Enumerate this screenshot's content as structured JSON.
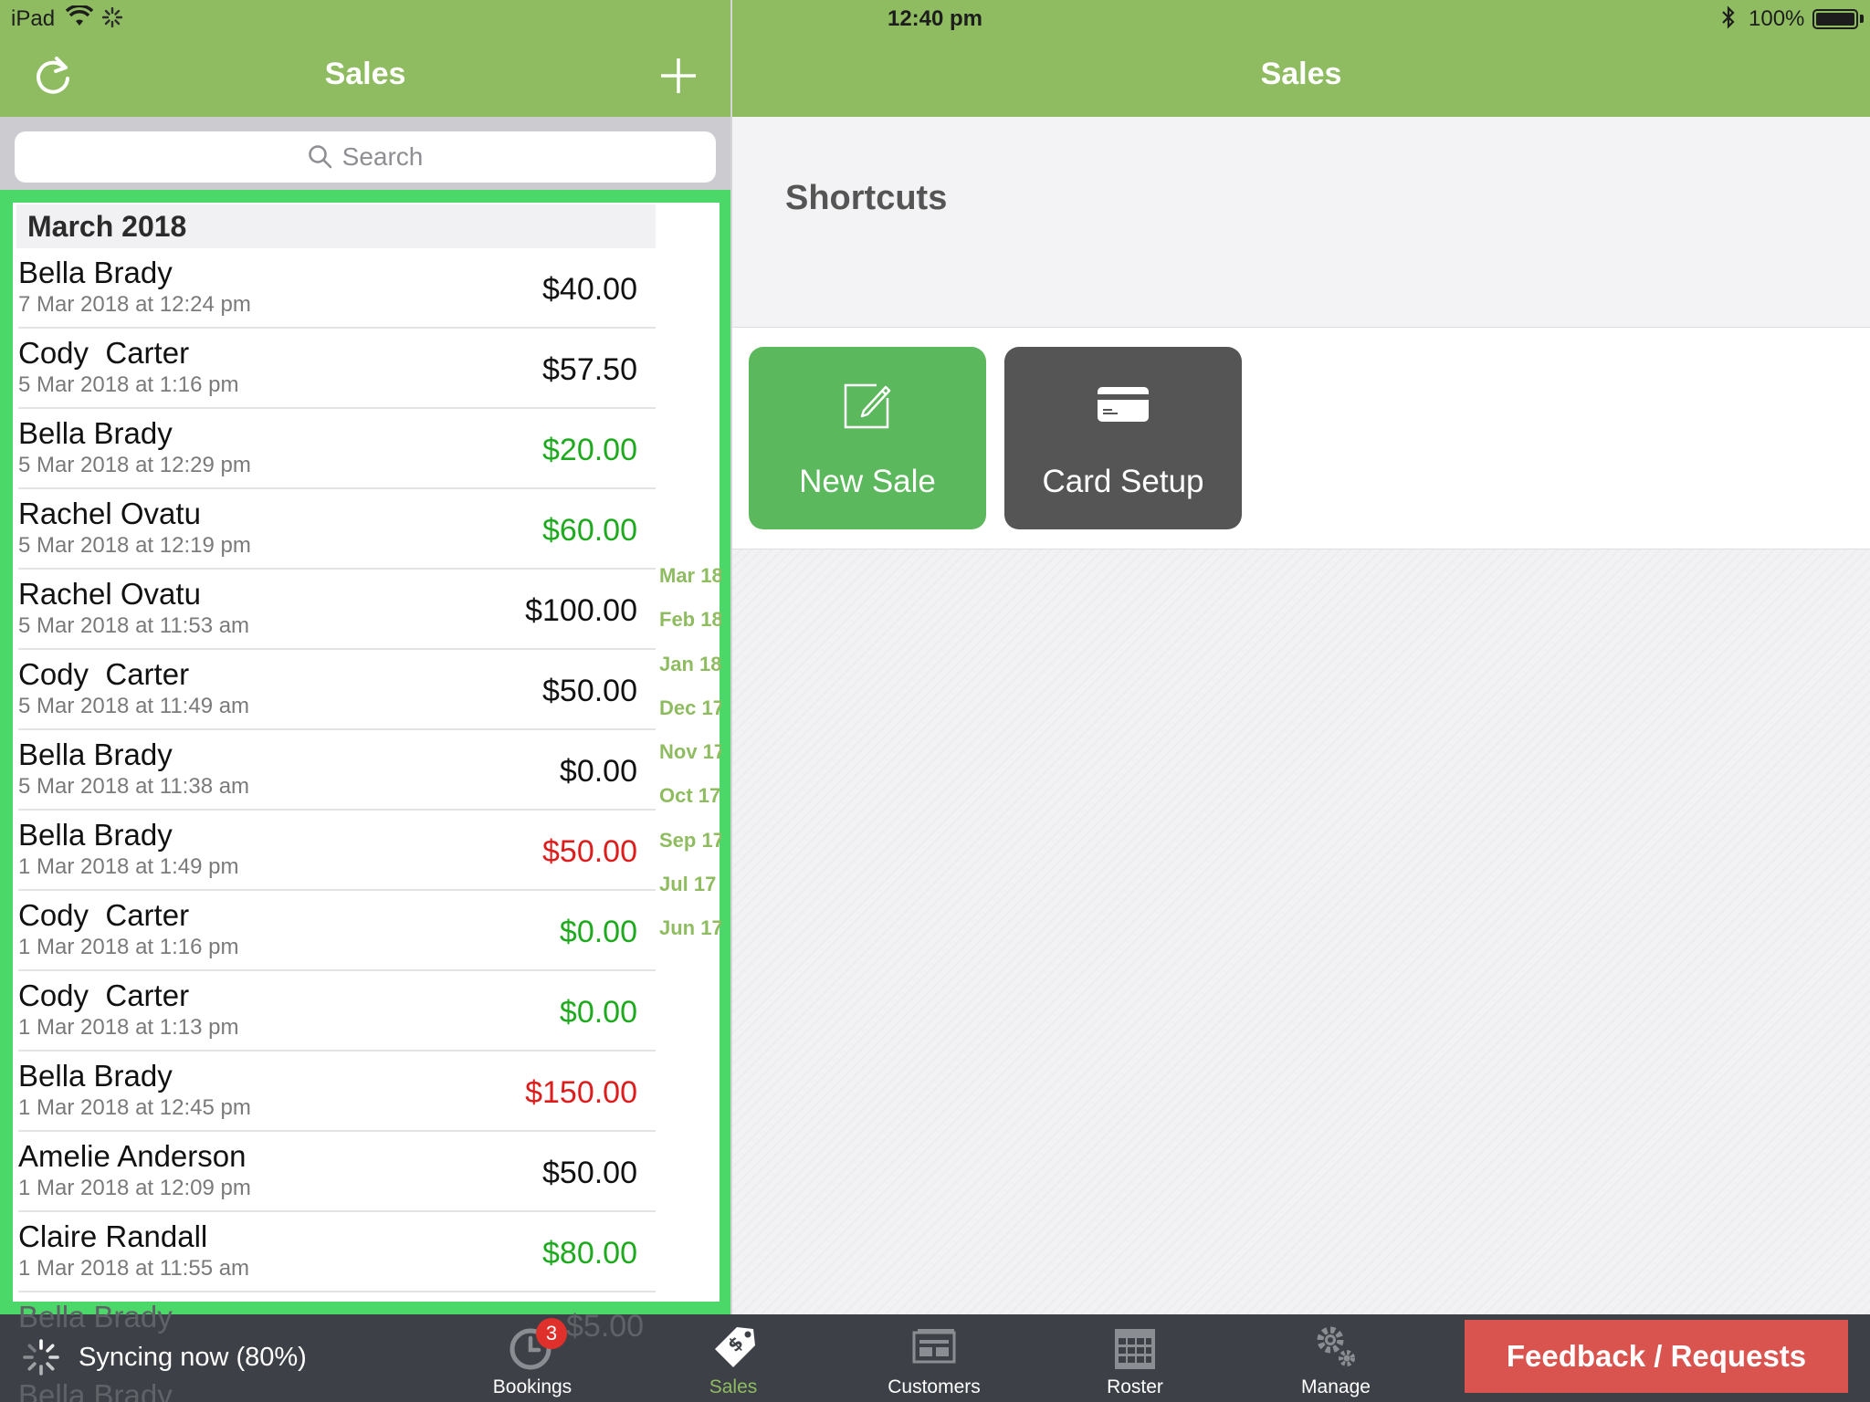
{
  "status_bar": {
    "device": "iPad",
    "time": "12:40 pm",
    "battery": "100%"
  },
  "left_header": {
    "title": "Sales"
  },
  "right_header": {
    "title": "Sales"
  },
  "search": {
    "placeholder": "Search"
  },
  "sales_list": {
    "section": "March 2018",
    "rows": [
      {
        "name": "Bella Brady",
        "date": "7 Mar 2018 at 12:24 pm",
        "amount": "$40.00",
        "status": "normal"
      },
      {
        "name": "Cody  Carter",
        "date": "5 Mar 2018 at 1:16 pm",
        "amount": "$57.50",
        "status": "normal"
      },
      {
        "name": "Bella Brady",
        "date": "5 Mar 2018 at 12:29 pm",
        "amount": "$20.00",
        "status": "paid"
      },
      {
        "name": "Rachel Ovatu",
        "date": "5 Mar 2018 at 12:19 pm",
        "amount": "$60.00",
        "status": "paid"
      },
      {
        "name": "Rachel Ovatu",
        "date": "5 Mar 2018 at 11:53 am",
        "amount": "$100.00",
        "status": "normal"
      },
      {
        "name": "Cody  Carter",
        "date": "5 Mar 2018 at 11:49 am",
        "amount": "$50.00",
        "status": "normal"
      },
      {
        "name": "Bella Brady",
        "date": "5 Mar 2018 at 11:38 am",
        "amount": "$0.00",
        "status": "normal"
      },
      {
        "name": "Bella Brady",
        "date": "1 Mar 2018 at 1:49 pm",
        "amount": "$50.00",
        "status": "refund"
      },
      {
        "name": "Cody  Carter",
        "date": "1 Mar 2018 at 1:16 pm",
        "amount": "$0.00",
        "status": "paid"
      },
      {
        "name": "Cody  Carter",
        "date": "1 Mar 2018 at 1:13 pm",
        "amount": "$0.00",
        "status": "paid"
      },
      {
        "name": "Bella Brady",
        "date": "1 Mar 2018 at 12:45 pm",
        "amount": "$150.00",
        "status": "refund"
      },
      {
        "name": "Amelie Anderson",
        "date": "1 Mar 2018 at 12:09 pm",
        "amount": "$50.00",
        "status": "normal"
      },
      {
        "name": "Claire Randall",
        "date": "1 Mar 2018 at 11:55 am",
        "amount": "$80.00",
        "status": "paid"
      }
    ],
    "peek_rows": [
      {
        "name": "Bella Brady",
        "amount": "$5.00"
      },
      {
        "name": "Bella Brady"
      }
    ]
  },
  "index_list": [
    "Mar 18",
    "Feb 18",
    "Jan 18",
    "Dec 17",
    "Nov 17",
    "Oct 17",
    "Sep 17",
    "Jul 17",
    "Jun 17"
  ],
  "shortcuts": {
    "title": "Shortcuts",
    "new_sale": "New Sale",
    "card_setup": "Card Setup"
  },
  "tabbar": {
    "sync_text": "Syncing now (80%)",
    "tabs": [
      {
        "label": "Bookings",
        "badge": "3",
        "icon": "clock-icon"
      },
      {
        "label": "Sales",
        "icon": "sales-tag-icon",
        "active": true
      },
      {
        "label": "Customers",
        "icon": "customers-icon"
      },
      {
        "label": "Roster",
        "icon": "calendar-icon"
      },
      {
        "label": "Manage",
        "icon": "gears-icon"
      }
    ],
    "feedback": "Feedback / Requests"
  },
  "colors": {
    "brand": "#8fbc61",
    "paid": "#1eaa1e",
    "refund": "#dd1c1c",
    "list_highlight": "#4cd868",
    "feedback": "#d9534f"
  }
}
